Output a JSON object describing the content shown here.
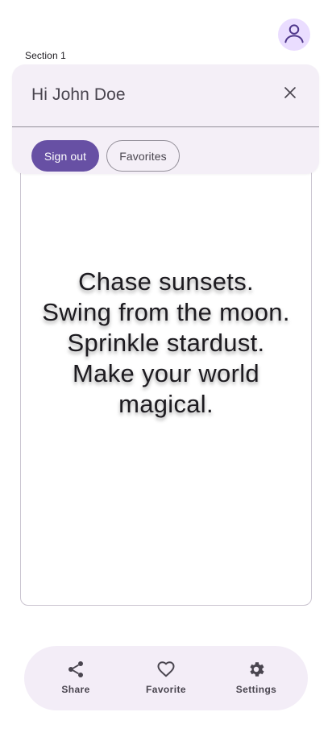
{
  "header": {
    "avatar_icon": "account-circle-icon",
    "section_label": "Section 1"
  },
  "account_sheet": {
    "greeting": "Hi John Doe",
    "close_icon": "close-icon",
    "sign_out_label": "Sign out",
    "favorites_label": "Favorites"
  },
  "quote": {
    "lines": [
      "Chase sunsets.",
      "Swing from the moon.",
      "Sprinkle stardust.",
      "Make your world",
      "magical."
    ]
  },
  "bottom_nav": {
    "items": [
      {
        "label": "Share",
        "icon": "share-icon"
      },
      {
        "label": "Favorite",
        "icon": "heart-icon"
      },
      {
        "label": "Settings",
        "icon": "gear-icon"
      }
    ]
  },
  "colors": {
    "primary": "#6750a4",
    "avatar_bg": "#eaddff",
    "sheet_bg": "#f4eff7",
    "nav_bg": "#f3edf7"
  }
}
